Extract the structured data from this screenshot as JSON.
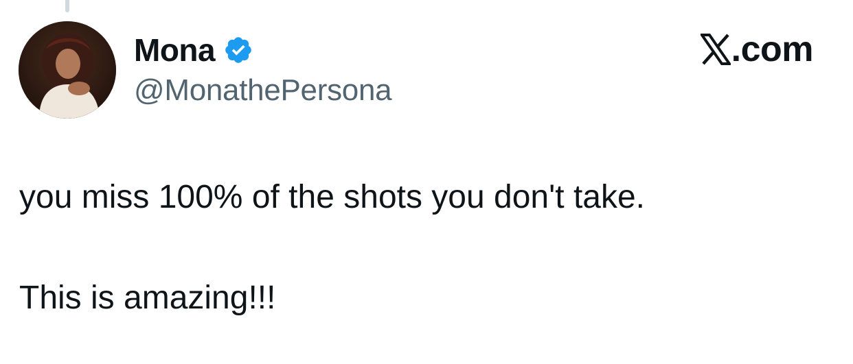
{
  "author": {
    "name": "Mona",
    "handle": "@MonathePersona",
    "verified": true,
    "verified_badge_color": "#1d9bf0"
  },
  "brand": {
    "label": ".com",
    "icon": "x-logo-icon"
  },
  "tweet": {
    "lines": [
      "you miss 100% of the shots you don't take.",
      "This is amazing!!!"
    ]
  },
  "colors": {
    "text": "#0f1419",
    "secondary_text": "#536471",
    "thread_line": "#cfd9de"
  }
}
